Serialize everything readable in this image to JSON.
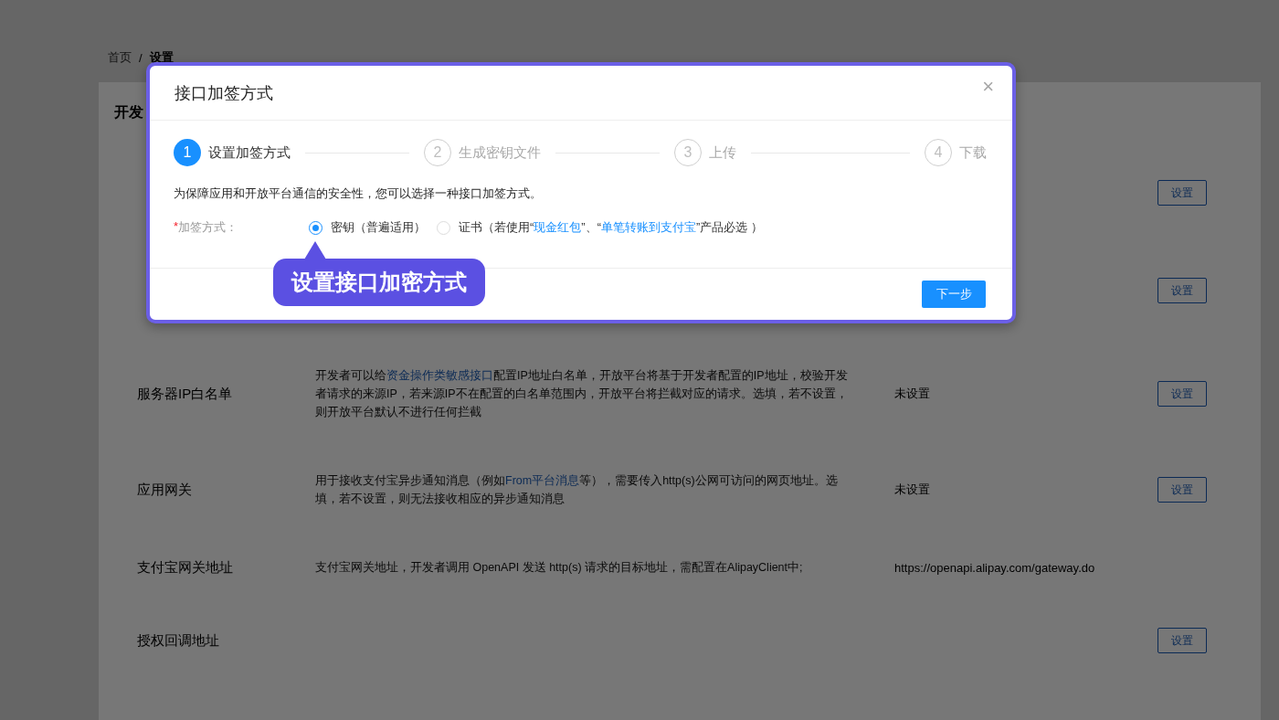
{
  "breadcrumb": [
    {
      "label": "首页",
      "selected": false,
      "separator": "/"
    },
    {
      "label": "设置",
      "selected": true
    }
  ],
  "card": {
    "title": "开发",
    "rows": [
      {
        "button": "设置"
      },
      {
        "button": "设置"
      },
      {
        "label": "服务器IP白名单",
        "description": [
          {
            "text": "开发者可以给"
          },
          {
            "text": "资金操作类敏感接口",
            "link": true
          },
          {
            "text": "配置IP地址白名单，开放平台将基于开发者配置的IP地址，校验开发者请求的来源IP，若来源IP不在配置的白名单范围内，开放平台将拦截对应的请求。选填，若不设置，则开放平台默认不进行任何拦截"
          }
        ],
        "value": "未设置",
        "button": "设置"
      },
      {
        "label": "应用网关",
        "description": [
          {
            "text": "用于接收支付宝异步通知消息（例如"
          },
          {
            "text": "From平台消息",
            "link": true
          },
          {
            "text": "等），需要传入http(s)公网可访问的网页地址。选填，若不设置，则无法接收相应的异步通知消息"
          }
        ],
        "value": "未设置",
        "button": "设置"
      },
      {
        "label": "支付宝网关地址",
        "description": [
          {
            "text": "支付宝网关地址，开发者调用 OpenAPI 发送 http(s) 请求的目标地址，需配置在AlipayClient中;"
          }
        ],
        "value": "https://openapi.alipay.com/gateway.do"
      },
      {
        "label": "授权回调地址",
        "button": "设置"
      }
    ]
  },
  "modal": {
    "title": "接口加签方式",
    "close": "×",
    "steps": [
      {
        "number": "1",
        "label": "设置加签方式",
        "selected": true
      },
      {
        "number": "2",
        "label": "生成密钥文件",
        "selected": false
      },
      {
        "number": "3",
        "label": "上传",
        "selected": false
      },
      {
        "number": "4",
        "label": "下载",
        "selected": false
      }
    ],
    "intro": "为保障应用和开放平台通信的安全性，您可以选择一种接口加签方式。",
    "field": {
      "required_mark": "*",
      "label": "加签方式：",
      "options": [
        {
          "label": [
            {
              "text": "密钥（普遍适用）"
            }
          ],
          "selected": true
        },
        {
          "label": [
            {
              "text": "证书（若使用“"
            },
            {
              "text": "现金红包",
              "link": true
            },
            {
              "text": "”、“"
            },
            {
              "text": "单笔转账到支付宝",
              "link": true
            },
            {
              "text": "”产品必选 ）"
            }
          ],
          "selected": false
        }
      ]
    },
    "next_button": "下一步"
  },
  "tooltip": {
    "text": "设置接口加密方式"
  }
}
